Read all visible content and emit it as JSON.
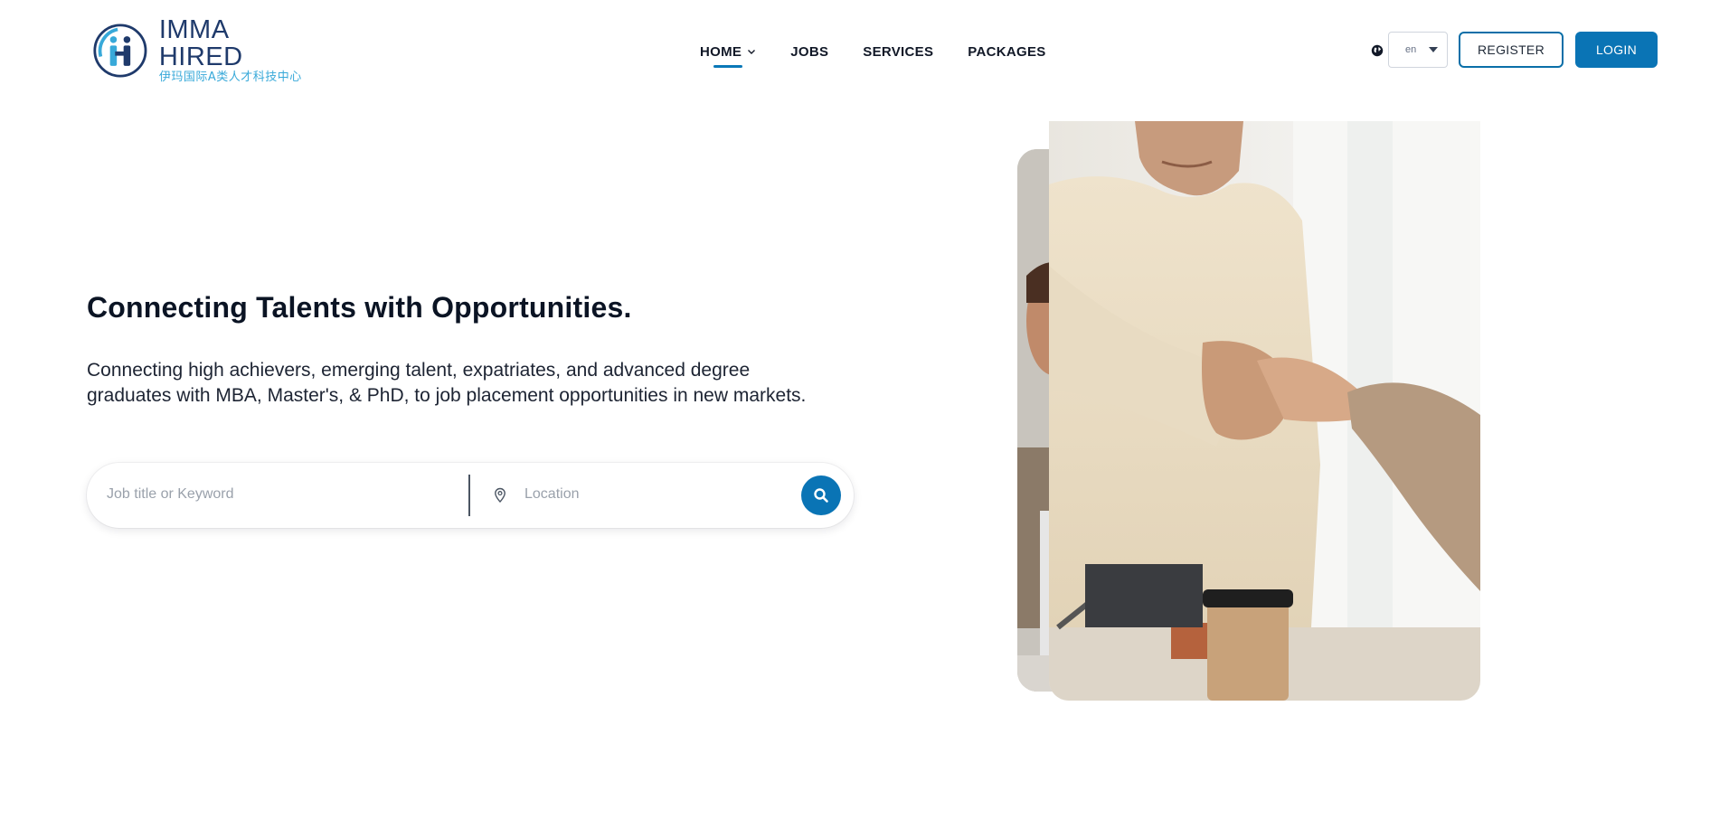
{
  "brand": {
    "name": "IMMA HIRED",
    "subtitle": "伊玛国际A类人才科技中心",
    "colors": {
      "primary": "#0a74b5",
      "logo_dark": "#1f3a6b",
      "logo_light": "#38a9d9"
    }
  },
  "nav": {
    "items": [
      {
        "label": "HOME",
        "active": true,
        "has_dropdown": true
      },
      {
        "label": "JOBS",
        "active": false
      },
      {
        "label": "SERVICES",
        "active": false
      },
      {
        "label": "PACKAGES",
        "active": false
      }
    ]
  },
  "header": {
    "language": {
      "icon": "globe-icon",
      "selected": "en"
    },
    "register_label": "REGISTER",
    "login_label": "LOGIN"
  },
  "hero": {
    "title": "Connecting Talents with Opportunities.",
    "description": "Connecting high achievers, emerging talent, expatriates, and advanced degree graduates with MBA, Master's, & PhD, to job placement opportunities in new markets.",
    "search": {
      "keyword_placeholder": "Job title or Keyword",
      "location_placeholder": "Location",
      "location_icon": "map-pin-icon",
      "submit_icon": "search-icon"
    },
    "image": {
      "icon": "handshake-photo"
    }
  }
}
